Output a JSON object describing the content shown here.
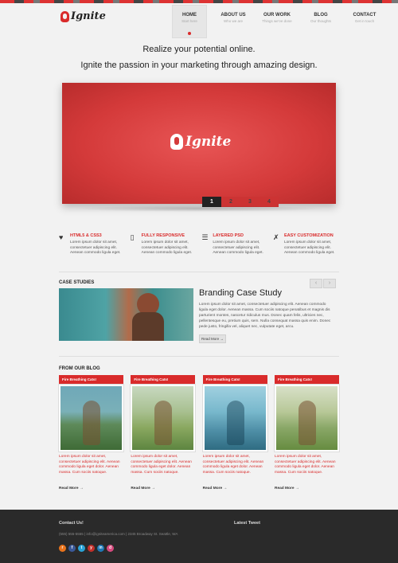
{
  "header": {
    "logo_text": "Ignite",
    "nav": [
      {
        "label": "HOME",
        "sub": "Start here"
      },
      {
        "label": "ABOUT US",
        "sub": "Who we are"
      },
      {
        "label": "OUR WORK",
        "sub": "Things we've done"
      },
      {
        "label": "BLOG",
        "sub": "Our thoughts"
      },
      {
        "label": "CONTACT",
        "sub": "Get in touch"
      }
    ]
  },
  "tagline": {
    "line1": "Realize your potential online.",
    "line2": "Ignite the passion in your marketing through amazing design."
  },
  "hero": {
    "logo_text": "Ignite",
    "slides": [
      "1",
      "2",
      "3",
      "4"
    ],
    "active_slide": "1"
  },
  "features": [
    {
      "icon": "heart-icon",
      "title": "HTML5 & CSS3",
      "text": "Lorem ipsum dolor sit amet, consectetuer adipiscing elit. Aenean commodo ligula eget."
    },
    {
      "icon": "phone-icon",
      "title": "FULLY RESPONSIVE",
      "text": "Lorem ipsum dolor sit amet, consectetuer adipiscing elit. Aenean commodo ligula eget."
    },
    {
      "icon": "layers-icon",
      "title": "LAYERED PSD",
      "text": "Lorem ipsum dolor sit amet, consectetuer adipiscing elit. Aenean commodo ligula eget."
    },
    {
      "icon": "wrench-icon",
      "title": "EASY CUSTOMIZATION",
      "text": "Lorem ipsum dolor sit amet, consectetuer adipiscing elit. Aenean commodo ligula eget."
    }
  ],
  "case_studies": {
    "section_title": "CASE STUDIES",
    "prev_arrow": "‹",
    "next_arrow": "›",
    "title": "Branding Case Study",
    "text": "Lorem ipsum dolor sit amet, consectetuer adipiscing elit. Aenean commodo ligula eget dolor. Aenean massa. Cum sociis natoque penatibus et magnis dis parturient montes, nascetur ridiculus mus. Donec quam felis, ultricies nec, pellentesque eu, pretium quis, sem. Nulla consequat massa quis enim. Donec pede justo, fringilla vel, aliquet nec, vulputate eget, arcu.",
    "button_label": "Read More →"
  },
  "blog": {
    "section_title": "FROM OUR BLOG",
    "posts": [
      {
        "title": "Fire Breathing Cats!",
        "text": "Lorem ipsum dolor sit amet, consectetuer adipiscing elit. Aenean commodo ligula eget dolor. Aenean massa. Cum sociis natoque.",
        "more": "Read More →"
      },
      {
        "title": "Fire Breathing Cats!",
        "text": "Lorem ipsum dolor sit amet, consectetuer adipiscing elit. Aenean commodo ligula eget dolor. Aenean massa. Cum sociis natoque.",
        "more": "Read More →"
      },
      {
        "title": "Fire Breathing Cats!",
        "text": "Lorem ipsum dolor sit amet, consectetuer adipiscing elit. Aenean commodo ligula eget dolor. Aenean massa. Cum sociis natoque.",
        "more": "Read More →"
      },
      {
        "title": "Fire Breathing Cats!",
        "text": "Lorem ipsum dolor sit amet, consectetuer adipiscing elit. Aenean commodo ligula eget dolor. Aenean massa. Cum sociis natoque.",
        "more": "Read More →"
      }
    ]
  },
  "footer": {
    "contact_title": "Contact Us!",
    "contact_info": "(555) 555-5555  |  info@igniteamerica.com  |  2345 Broadway St. Seattle, WA",
    "tweet_title": "Latest Tweet",
    "social": [
      {
        "icon": "rss-icon",
        "glyph": "r",
        "color": "#e8731c"
      },
      {
        "icon": "facebook-icon",
        "glyph": "f",
        "color": "#3b5998"
      },
      {
        "icon": "twitter-icon",
        "glyph": "t",
        "color": "#2aa3d6"
      },
      {
        "icon": "youtube-icon",
        "glyph": "y",
        "color": "#c4302b"
      },
      {
        "icon": "linkedin-icon",
        "glyph": "in",
        "color": "#1d77b4"
      },
      {
        "icon": "dribbble-icon",
        "glyph": "d",
        "color": "#d64a7e"
      }
    ]
  },
  "colors": {
    "accent": "#d92b2b",
    "footer_bg": "#2a2a2a",
    "page_bg": "#f2f2f2"
  }
}
